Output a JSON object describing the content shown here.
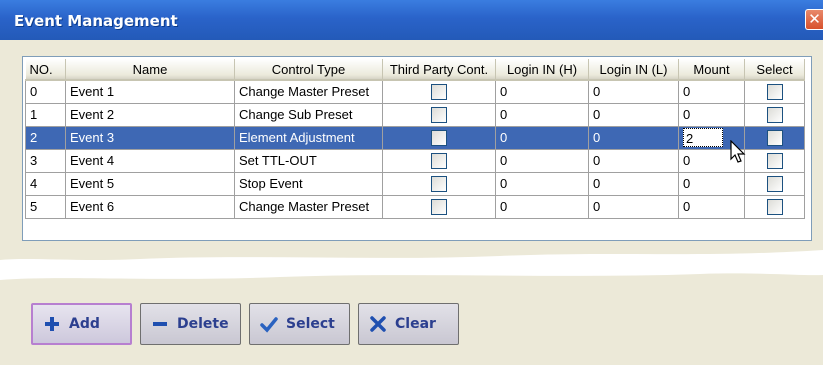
{
  "window": {
    "title": "Event Management"
  },
  "table": {
    "columns": [
      "NO.",
      "Name",
      "Control Type",
      "Third Party Cont.",
      "Login IN (H)",
      "Login IN (L)",
      "Mount",
      "Select"
    ],
    "rows": [
      {
        "no": "0",
        "name": "Event 1",
        "control_type": "Change Master Preset",
        "third_party": false,
        "login_h": "0",
        "login_l": "0",
        "mount": "0",
        "select": false
      },
      {
        "no": "1",
        "name": "Event 2",
        "control_type": "Change Sub Preset",
        "third_party": false,
        "login_h": "0",
        "login_l": "0",
        "mount": "0",
        "select": false
      },
      {
        "no": "2",
        "name": "Event 3",
        "control_type": "Element Adjustment",
        "third_party": false,
        "login_h": "0",
        "login_l": "0",
        "mount": "2",
        "select": false,
        "selected": true
      },
      {
        "no": "3",
        "name": "Event 4",
        "control_type": "Set TTL-OUT",
        "third_party": false,
        "login_h": "0",
        "login_l": "0",
        "mount": "0",
        "select": false
      },
      {
        "no": "4",
        "name": "Event 5",
        "control_type": "Stop Event",
        "third_party": false,
        "login_h": "0",
        "login_l": "0",
        "mount": "0",
        "select": false
      },
      {
        "no": "5",
        "name": "Event 6",
        "control_type": "Change Master Preset",
        "third_party": false,
        "login_h": "0",
        "login_l": "0",
        "mount": "0",
        "select": false
      }
    ]
  },
  "buttons": {
    "add": "Add",
    "delete": "Delete",
    "select": "Select",
    "clear": "Clear"
  },
  "colors": {
    "titlebar": "#2a63c9",
    "selected_row": "#3e68b4",
    "button_text": "#2c3f8f",
    "add_icon": "#1f4fb0",
    "delete_icon": "#1f4fb0"
  },
  "icons": {
    "close": "close-icon",
    "add": "plus-icon",
    "delete": "minus-icon",
    "select": "checkmark-icon",
    "clear": "x-icon",
    "cursor": "mouse-pointer-icon"
  }
}
